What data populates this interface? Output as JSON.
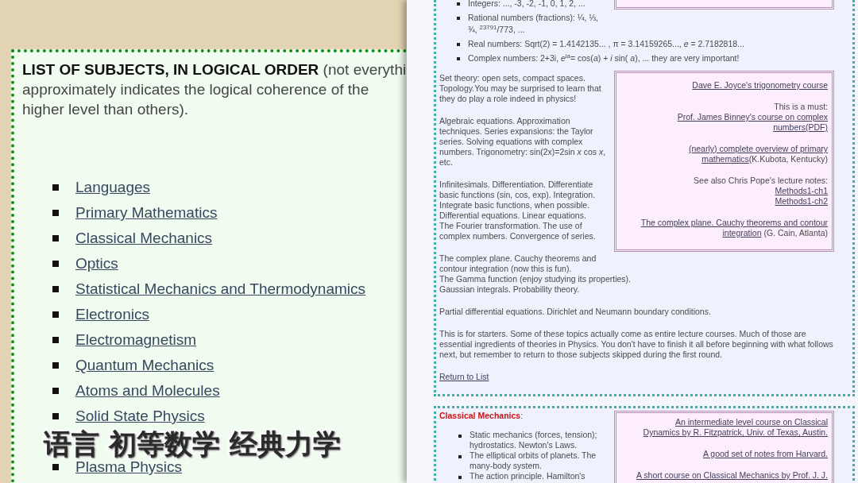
{
  "subtitle": "语言 初等数学 经典力学",
  "left_page": {
    "intro_lines": [
      "**LIST OF SUBJECTS, IN LOGICAL ORDER** (not everythi",
      "approximately indicates the logical coherence of the",
      "higher level than others)."
    ],
    "subjects": [
      "Languages",
      "Primary Mathematics",
      "Classical Mechanics",
      "Optics",
      "Statistical Mechanics and Thermodynamics",
      "Electronics",
      "Electromagnetism",
      "Quantum Mechanics",
      "Atoms and Molecules",
      "Solid State Physics",
      "Plasma Physics"
    ]
  },
  "math_section": {
    "number_list": [
      {
        "lines": [
          "Integers: ..., -3, -2, -1, 0, 1, 2, ..."
        ]
      },
      {
        "lines": [
          "Rational numbers (fractions): ¼, ⅓,",
          "¾, $^{23791}$/773, ..."
        ]
      },
      {
        "lines": [
          "Real numbers: Sqrt(2) = 1.4142135... , π = 3.14159265..., *e* = 2.7182818..."
        ]
      },
      {
        "lines": [
          "Complex numbers: 2+3i, *e*$^{ia}$= cos(*a*) + *i* sin( *a*), ... they are very important!"
        ]
      }
    ],
    "paragraphs": [
      {
        "lines": [
          "Set theory: open sets, compact spaces.",
          "Topology.You may be surprised to learn that",
          "they do play a role indeed in physics!"
        ]
      },
      {
        "lines": [
          "Algebraic equations. Approximation",
          "techniques. Series expansions: the Taylor",
          "series. Solving equations with complex",
          "numbers. Trigonometry: sin(2x)=2sin *x* cos *x*,",
          "etc."
        ]
      },
      {
        "lines": [
          "Infinitesimals. Differentiation. Differentiate",
          "basic functions (sin, cos, exp). Integration.",
          "Integrate basic functions, when possible.",
          "Differential equations. Linear equations.",
          "The Fourier transformation. The use of",
          "complex numbers. Convergence of series."
        ]
      },
      {
        "lines": [
          "The complex plane. Cauchy theorems and",
          "contour integration (now this is fun).",
          "The Gamma function (enjoy studying its properties).",
          "Gaussian integrals. Probability theory."
        ]
      },
      {
        "lines": [
          "Partial differential equations. Dirichlet and Neumann boundary conditions."
        ]
      },
      {
        "lines": [
          "This is for starters. Some of these topics actually come as entire lecture courses. Much of those are",
          "essential ingredients of theories in Physics. You don't have to finish it all before beginning with what follows",
          "next, but remember to return to those subjects skipped during the first round."
        ]
      }
    ],
    "links_box": [
      {
        "lines": [
          [
            {
              "kind": "link",
              "text": "Dave E. Joyce's trigonometry course"
            }
          ]
        ]
      },
      {
        "lines": [
          [
            {
              "kind": "text",
              "text": "This is a must:"
            }
          ],
          [
            {
              "kind": "link",
              "text": "Prof. James Binney's course on complex"
            }
          ],
          [
            {
              "kind": "link",
              "text": "numbers(PDF)"
            }
          ]
        ]
      },
      {
        "lines": [
          [
            {
              "kind": "link",
              "text": "(nearly) complete overview of primary"
            }
          ],
          [
            {
              "kind": "link",
              "text": "mathematics"
            },
            {
              "kind": "text",
              "text": "(K.Kubota, Kentucky)"
            }
          ]
        ]
      },
      {
        "lines": [
          [
            {
              "kind": "text",
              "text": "See also Chris Pope's lecture notes:"
            }
          ],
          [
            {
              "kind": "link",
              "text": "Methods1-ch1"
            }
          ],
          [
            {
              "kind": "link",
              "text": "Methods1-ch2"
            }
          ]
        ]
      },
      {
        "lines": [
          [
            {
              "kind": "link",
              "text": "The complex plane. Cauchy theorems and contour"
            }
          ],
          [
            {
              "kind": "link",
              "text": "integration"
            },
            {
              "kind": "text",
              "text": " (G. Cain, Atlanta)"
            }
          ]
        ]
      }
    ],
    "return_link": "Return to List"
  },
  "mechanics_section": {
    "heading": "**Classical Mechanics**:",
    "topics": [
      {
        "lines": [
          "Static mechanics (forces, tension);",
          "hydrostatics. Newton's Laws."
        ]
      },
      {
        "lines": [
          "The elliptical orbits of planets. The",
          "many-body system."
        ]
      },
      {
        "lines": [
          "The action principle. Hamilton's"
        ]
      }
    ],
    "links_box": [
      {
        "lines": [
          [
            {
              "kind": "link",
              "text": "An intermediate level course on Classical"
            }
          ],
          [
            {
              "kind": "link",
              "text": "Dynamics by R. Fitzpatrick, Univ. of Texas, Austin."
            }
          ]
        ]
      },
      {
        "lines": [
          [
            {
              "kind": "link",
              "text": "A good set of notes from Harvard."
            }
          ]
        ]
      },
      {
        "lines": [
          [
            {
              "kind": "link",
              "text": "A short course on Classical Mechanics by Prof. J. J."
            }
          ]
        ]
      }
    ]
  }
}
